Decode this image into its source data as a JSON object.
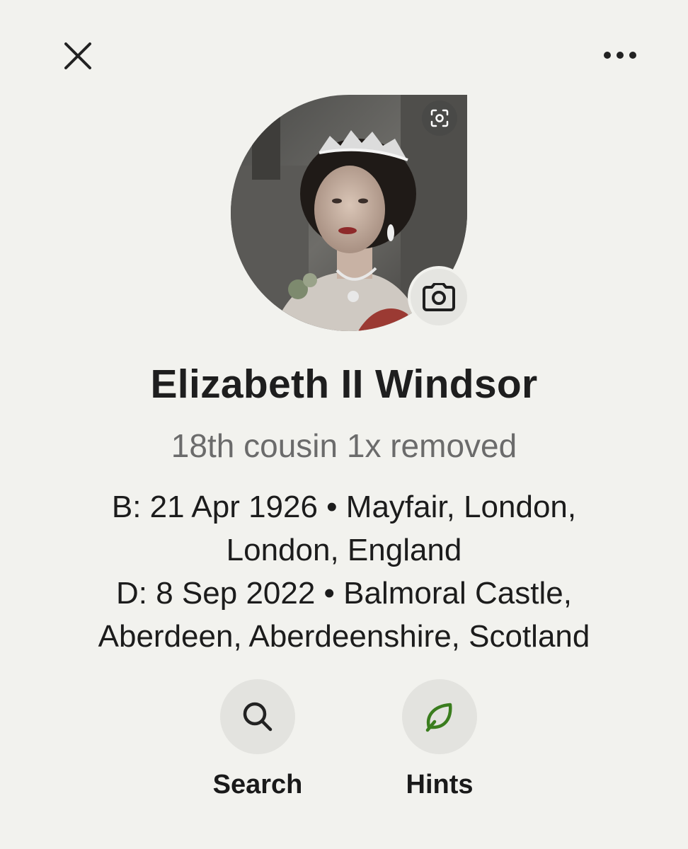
{
  "header": {
    "close_icon": "close-icon",
    "more_icon": "more-options-icon"
  },
  "profile": {
    "name": "Elizabeth II Windsor",
    "relationship": "18th cousin 1x removed",
    "birth_line_1": "B: 21 Apr 1926 • Mayfair, London,",
    "birth_line_2": "London, England",
    "death_line_1": "D: 8 Sep 2022 • Balmoral Castle,",
    "death_line_2": "Aberdeen, Aberdeenshire, Scotland",
    "photo_icons": {
      "focus": "face-focus-icon",
      "camera": "camera-icon"
    }
  },
  "actions": [
    {
      "label": "Search",
      "icon": "search-icon"
    },
    {
      "label": "Hints",
      "icon": "leaf-icon",
      "icon_color": "#3a7d1e"
    }
  ],
  "colors": {
    "background": "#f2f2ee",
    "secondary_text": "#6b6b6b",
    "hint_green": "#3a7d1e"
  }
}
